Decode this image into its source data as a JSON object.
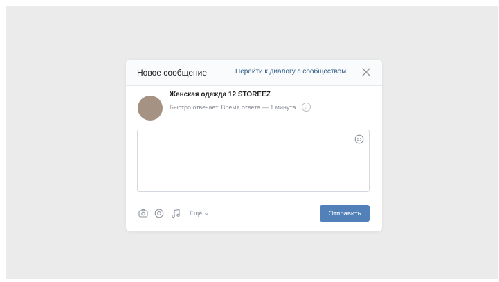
{
  "modal": {
    "title": "Новое сообщение",
    "goto_dialog_link": "Перейти к диалогу с сообществом",
    "close_icon": "close-icon"
  },
  "community": {
    "name": "Женская одежда 12 STOREEZ",
    "status": "Быстро отвечает. Время ответа — 1 минута",
    "help_icon_glyph": "?",
    "avatar_color": "#a69282"
  },
  "composer": {
    "value": "",
    "emoji_icon": "smile-icon"
  },
  "toolbar": {
    "photo_icon": "camera-icon",
    "video_icon": "video-icon",
    "audio_icon": "music-note-icon",
    "more_label": "Ещё",
    "send_label": "Отправить"
  },
  "colors": {
    "accent": "#5181b8",
    "link": "#2a5885",
    "background": "#ebebeb"
  }
}
